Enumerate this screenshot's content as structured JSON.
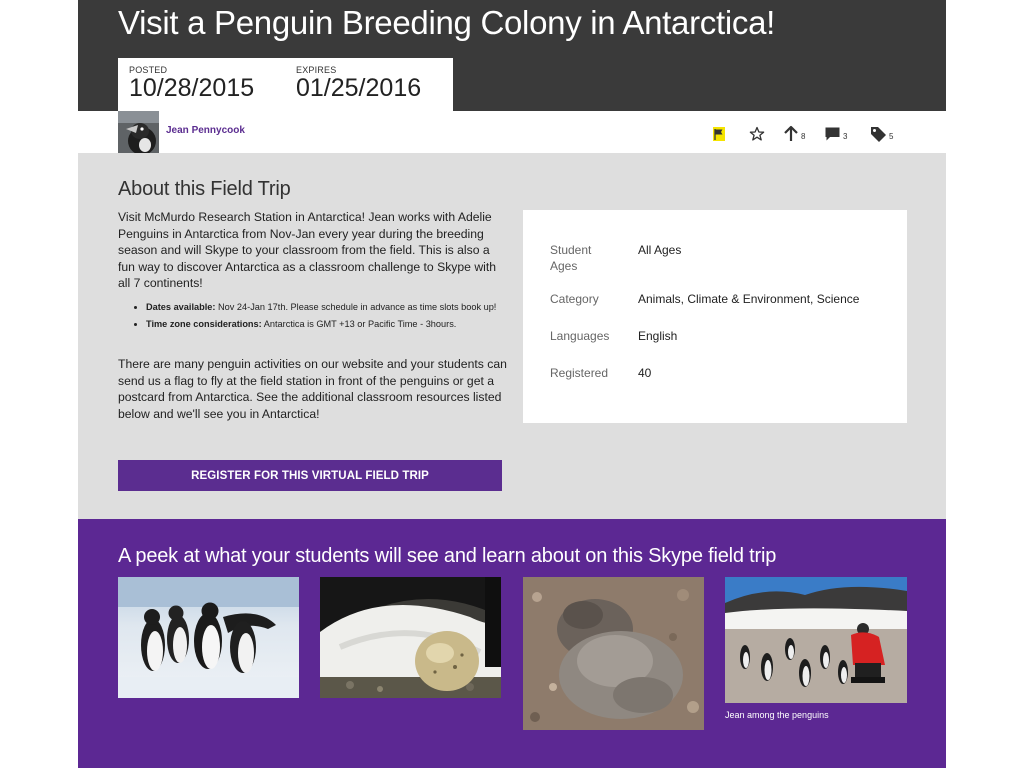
{
  "header": {
    "title": "Visit a Penguin Breeding Colony in Antarctica!",
    "posted_label": "POSTED",
    "posted_date": "10/28/2015",
    "expires_label": "EXPIRES",
    "expires_date": "01/25/2016"
  },
  "author": {
    "name": "Jean Pennycook"
  },
  "actions": {
    "flag_icon": "flag-icon",
    "flag_color": "#f5e400",
    "favorite_icon": "star-icon",
    "upvote_icon": "arrow-up-icon",
    "upvote_count": "8",
    "comment_icon": "comment-icon",
    "comment_count": "3",
    "tag_icon": "tag-icon",
    "tag_count": "5"
  },
  "about": {
    "heading": "About this Field Trip",
    "paragraph1": "Visit McMurdo Research Station in Antarctica! Jean works with Adelie Penguins in Antarctica from Nov-Jan every year during the breeding season and will Skype to your classroom from the field. This is also a fun way to discover Antarctica as a classroom challenge to Skype with all 7 continents!",
    "bullets": [
      {
        "label": "Dates available:",
        "text": " Nov 24-Jan 17th. Please schedule in advance as time slots book up!"
      },
      {
        "label": "Time zone considerations:",
        "text": " Antarctica is GMT +13 or Pacific Time - 3hours."
      }
    ],
    "paragraph2": "There are many penguin activities on our website and your students can send us a flag to fly at the field station in front of the penguins or get a postcard from Antarctica. See the additional classroom resources listed below and we'll see you in Antarctica!",
    "register_label": "REGISTER FOR THIS VIRTUAL FIELD TRIP"
  },
  "details": {
    "student_ages_label": "Student Ages",
    "student_ages": "All Ages",
    "category_label": "Category",
    "category": "Animals, Climate & Environment, Science",
    "languages_label": "Languages",
    "languages": "English",
    "registered_label": "Registered",
    "registered": "40"
  },
  "gallery": {
    "heading": "A peek at what your students will see and learn about on this Skype field trip",
    "caption": "Jean among the penguins"
  },
  "colors": {
    "header_bg": "#3a3a3a",
    "accent_purple": "#5c2893",
    "about_bg": "#dedede",
    "author_link": "#5b2d90"
  }
}
